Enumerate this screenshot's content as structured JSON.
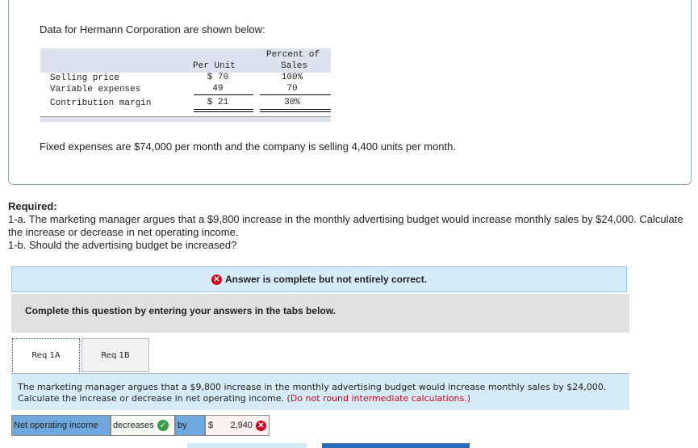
{
  "intro": "Data for Hermann Corporation are shown below:",
  "table": {
    "col1_header": "Per Unit",
    "col2_header_line1": "Percent of",
    "col2_header_line2": "Sales",
    "rows": [
      {
        "label": "Selling price",
        "per_unit": "$ 70",
        "percent": "100%"
      },
      {
        "label": "Variable expenses",
        "per_unit": "49",
        "percent": "70"
      },
      {
        "label": "Contribution margin",
        "per_unit": "$ 21",
        "percent": "30%"
      }
    ]
  },
  "fixed": "Fixed expenses are $74,000 per month and the company is selling 4,400 units per month.",
  "required": {
    "title": "Required:",
    "q1a": "1-a. The marketing manager argues that a $9,800 increase in the monthly advertising budget would increase monthly sales by $24,000. Calculate the increase or decrease in net operating income.",
    "q1b": "1-b. Should the advertising budget be increased?"
  },
  "answer_status": "Answer is complete but not entirely correct.",
  "instruction": "Complete this question by entering your answers in the tabs below.",
  "tabs": [
    "Req 1A",
    "Req 1B"
  ],
  "question": "The marketing manager argues that a $9,800 increase in the monthly advertising budget would increase monthly sales by $24,000. Calculate the increase or decrease in net operating income.",
  "question_note": "(Do not round intermediate calculations.)",
  "answer_row": {
    "label": "Net operating income",
    "direction": "decreases",
    "by": "by",
    "currency": "$",
    "amount": "2,940"
  },
  "colors": {
    "accent": "#6fa8dc",
    "error": "#d0021b",
    "success": "#3c9a4c"
  }
}
